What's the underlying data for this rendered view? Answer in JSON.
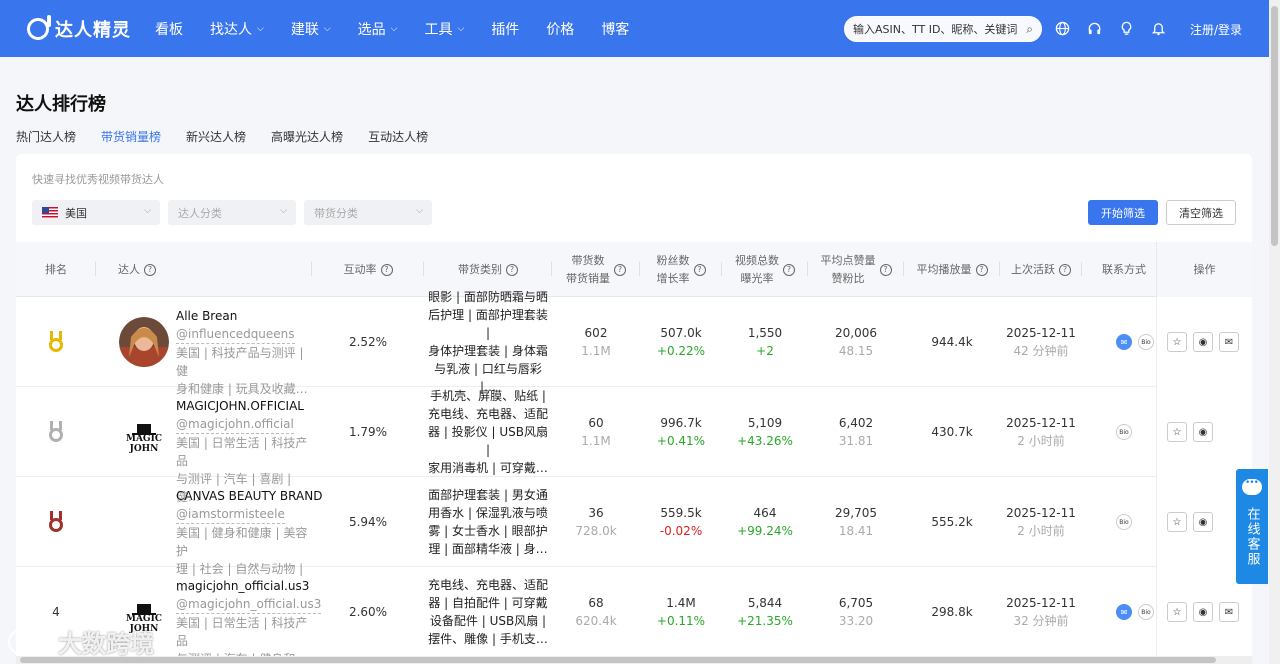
{
  "header": {
    "logo": "达人精灵",
    "nav": [
      {
        "label": "看板",
        "dropdown": false
      },
      {
        "label": "找达人",
        "dropdown": true
      },
      {
        "label": "建联",
        "dropdown": true
      },
      {
        "label": "选品",
        "dropdown": true
      },
      {
        "label": "工具",
        "dropdown": true
      },
      {
        "label": "插件",
        "dropdown": false
      },
      {
        "label": "价格",
        "dropdown": false
      },
      {
        "label": "博客",
        "dropdown": false
      }
    ],
    "search_placeholder": "输入ASIN、TT ID、昵称、关键词",
    "login": "注册/登录",
    "icons": [
      "globe-icon",
      "headset-icon",
      "bulb-icon",
      "bell-icon"
    ],
    "accent": "#3975ec"
  },
  "page": {
    "title": "达人排行榜",
    "tabs": [
      "热门达人榜",
      "带货销量榜",
      "新兴达人榜",
      "高曝光达人榜",
      "互动达人榜"
    ],
    "active_tab": "带货销量榜"
  },
  "filters": {
    "hint": "快速寻找优秀视频带货达人",
    "country": "美国",
    "category_placeholder": "达人分类",
    "goods_placeholder": "带货分类",
    "apply": "开始筛选",
    "clear": "清空筛选"
  },
  "table": {
    "headers": {
      "rank": "排名",
      "creator": "达人",
      "engagement": "互动率",
      "category": "带货类别",
      "sales_1": "带货数",
      "sales_2": "带货销量",
      "fans_1": "粉丝数",
      "fans_2": "增长率",
      "views_1": "视频总数",
      "views_2": "曝光率",
      "likes_1": "平均点赞量",
      "likes_2": "赞粉比",
      "plays": "平均播放量",
      "active": "上次活跃",
      "contact": "联系方式",
      "ops": "操作"
    },
    "rows": [
      {
        "rank": "",
        "medal": "gold",
        "name": "Alle Brean",
        "handle": "@influencedqueens",
        "tags": [
          "美国 | 科技产品与测评 | 健",
          "身和健康 | 玩具及收藏…"
        ],
        "engagement": "2.52%",
        "cats": [
          "眼影 | 面部防晒霜与晒",
          "后护理 | 面部护理套装 |",
          "身体护理套装 | 身体霜",
          "与乳液 | 口红与唇彩 |…"
        ],
        "items": "602",
        "sales": "1.1M",
        "fans": "507.0k",
        "fans_growth": "+0.22%",
        "fans_dir": "up",
        "videos": "1,550",
        "exposure": "+2",
        "exposure_dir": "up",
        "avg_likes": "20,006",
        "like_ratio": "48.15",
        "avg_plays": "944.4k",
        "last_date": "2025-12-11",
        "last_ago": "42 分钟前",
        "contact": [
          "mail",
          "bio"
        ],
        "has_mail_op": true
      },
      {
        "rank": "",
        "medal": "silver",
        "name": "MAGICJOHN.OFFICIAL",
        "handle": "@magicjohn.official",
        "tags": [
          "美国 | 日常生活 | 科技产品",
          "与测评 | 汽车 | 喜剧 | 健…"
        ],
        "engagement": "1.79%",
        "cats": [
          "手机壳、屏膜、贴纸 |",
          "充电线、充电器、适配",
          "器 | 投影仪 | USB风扇 |",
          "家用消毒机 | 可穿戴…"
        ],
        "items": "60",
        "sales": "1.1M",
        "fans": "996.7k",
        "fans_growth": "+0.41%",
        "fans_dir": "up",
        "videos": "5,109",
        "exposure": "+43.26%",
        "exposure_dir": "up",
        "avg_likes": "6,402",
        "like_ratio": "31.81",
        "avg_plays": "430.7k",
        "last_date": "2025-12-11",
        "last_ago": "2 小时前",
        "contact": [
          "bio"
        ],
        "has_mail_op": false
      },
      {
        "rank": "",
        "medal": "bronze",
        "name": "CANVAS BEAUTY BRAND",
        "handle": "@iamstormisteele",
        "tags": [
          "美国 | 健身和健康 | 美容护",
          "理 | 社会 | 自然与动物 | …"
        ],
        "engagement": "5.94%",
        "cats": [
          "面部护理套装 | 男女通",
          "用香水 | 保湿乳液与喷",
          "雾 | 女士香水 | 眼部护",
          "理 | 面部精华液 | 身…"
        ],
        "items": "36",
        "sales": "728.0k",
        "fans": "559.5k",
        "fans_growth": "-0.02%",
        "fans_dir": "down",
        "videos": "464",
        "exposure": "+99.24%",
        "exposure_dir": "up",
        "avg_likes": "29,705",
        "like_ratio": "18.41",
        "avg_plays": "555.2k",
        "last_date": "2025-12-11",
        "last_ago": "2 小时前",
        "contact": [
          "bio"
        ],
        "has_mail_op": false
      },
      {
        "rank": "4",
        "medal": "",
        "name": "magicjohn_official.us3",
        "handle": "@magicjohn_official.us3",
        "tags": [
          "美国 | 日常生活 | 科技产品",
          "与测评 | 汽车 | 健身和健…"
        ],
        "engagement": "2.60%",
        "cats": [
          "充电线、充电器、适配",
          "器 | 自拍配件 | 可穿戴",
          "设备配件 | USB风扇 |",
          "摆件、雕像 | 手机支…"
        ],
        "items": "68",
        "sales": "620.4k",
        "fans": "1.4M",
        "fans_growth": "+0.11%",
        "fans_dir": "up",
        "videos": "5,844",
        "exposure": "+21.35%",
        "exposure_dir": "up",
        "avg_likes": "6,705",
        "like_ratio": "33.20",
        "avg_plays": "298.8k",
        "last_date": "2025-12-11",
        "last_ago": "32 分钟前",
        "contact": [
          "mail",
          "bio"
        ],
        "has_mail_op": true
      }
    ],
    "magic_logo": [
      "MAGIC",
      "JOHN"
    ],
    "bio_label": "Bio"
  },
  "float_service": "在线客服",
  "watermark": "大数跨境",
  "colors": {
    "up": "#2aa82a",
    "down": "#e02020",
    "gold": "#e6b800",
    "silver": "#b0b0b0",
    "bronze": "#a0302a"
  }
}
